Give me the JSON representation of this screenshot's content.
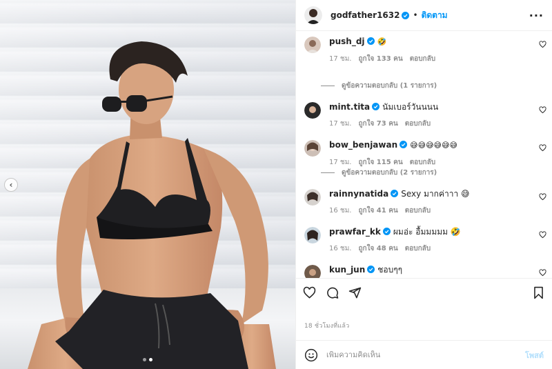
{
  "post": {
    "author": {
      "username": "godfather1632",
      "separator": "•",
      "follow_label": "ติดตาม",
      "more_icon": "more-icon"
    },
    "media": {
      "slide_index": 2,
      "slide_count": 2,
      "prev_icon": "chevron-left-icon"
    },
    "comments": [
      {
        "username": "push_dj",
        "verified": true,
        "text": "🤣",
        "time": "17 ชม.",
        "likes": "ถูกใจ 133 คน",
        "reply_label": "ตอบกลับ",
        "view_replies": "ดูข้อความตอบกลับ (1 รายการ)"
      },
      {
        "username": "mint.tita",
        "verified": true,
        "text": "นัมเบอร์วันนนน",
        "time": "17 ชม.",
        "likes": "ถูกใจ 73 คน",
        "reply_label": "ตอบกลับ"
      },
      {
        "username": "bow_benjawan",
        "verified": true,
        "text": "😅😅😅😅😅😅",
        "time": "17 ชม.",
        "likes": "ถูกใจ 115 คน",
        "reply_label": "ตอบกลับ",
        "view_replies": "ดูข้อความตอบกลับ (2 รายการ)"
      },
      {
        "username": "rainnynatida",
        "verified": true,
        "text": "Sexy มากค่าาา 😅",
        "time": "16 ชม.",
        "likes": "ถูกใจ 41 คน",
        "reply_label": "ตอบกลับ"
      },
      {
        "username": "prawfar_kk",
        "verified": true,
        "text": "ผมอ่ะ อื้มมมมม 🤣",
        "time": "16 ชม.",
        "likes": "ถูกใจ 48 คน",
        "reply_label": "ตอบกลับ"
      },
      {
        "username": "kun_jun",
        "verified": true,
        "text": "ชอบๆๆ"
      }
    ],
    "timestamp": "18 ชั่วโมงที่แล้ว",
    "add_comment": {
      "placeholder": "เพิ่มความคิดเห็น",
      "post_label": "โพสต์"
    },
    "colors": {
      "accent": "#0095f6",
      "verified": "#0095f6",
      "muted": "#8e8e8e",
      "post_disabled": "#b2dffc"
    }
  }
}
